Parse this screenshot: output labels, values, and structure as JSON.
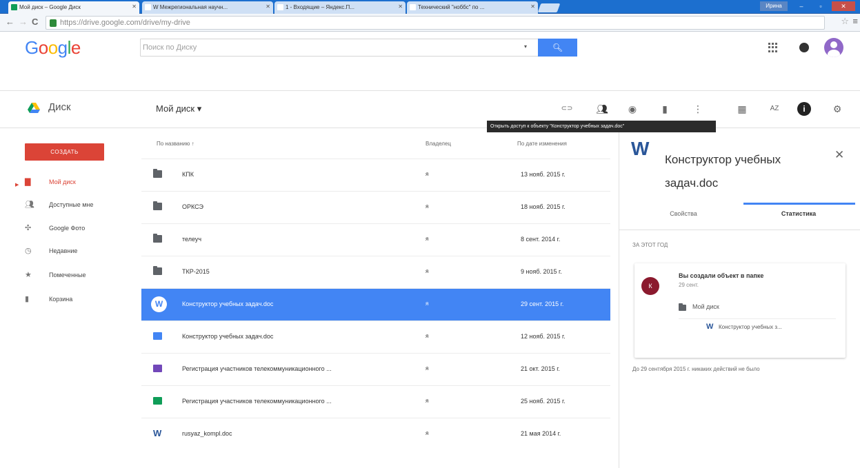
{
  "browser": {
    "tabs": [
      {
        "label": "Мой диск – Google Диск",
        "active": true,
        "favicon_color": "#0f9d58"
      },
      {
        "label": "W Межрегиональная научн...",
        "active": false,
        "favicon_color": "#ffffff"
      },
      {
        "label": "1 - Входящие – Яндекс.П...",
        "active": false,
        "favicon_color": "#ffffff"
      },
      {
        "label": "Технический \"ноббс\" по ...",
        "active": false,
        "favicon_color": "#ffffff"
      }
    ],
    "window_user": "Ирина",
    "url": "https://drive.google.com/drive/my-drive",
    "back_icon": "←",
    "forward_icon": "→",
    "reload_icon": "C",
    "star_icon": "☆",
    "menu_icon": "≡"
  },
  "header": {
    "logo": [
      "G",
      "o",
      "o",
      "g",
      "l",
      "e"
    ],
    "logo_colors": [
      "#4285f4",
      "#ea4335",
      "#fbbc05",
      "#4285f4",
      "#34a853",
      "#ea4335"
    ],
    "search_placeholder": "Поиск по Диску",
    "search_dropdown_icon": "▾",
    "search_button_icon": "🔍︎"
  },
  "subbar": {
    "app_title": "Диск",
    "breadcrumb": "Мой диск ▾",
    "tooltip": "Открыть доступ к объекту \"Конструктор учебных задач.doc\"",
    "toolbar": {
      "link_icon": "⊂⊃",
      "share_icon": "👥︎",
      "preview_icon": "◉",
      "trash_icon": "▮",
      "more_icon": "⋮",
      "grid_icon": "▦",
      "sort_icon": "AZ",
      "info_icon": "i",
      "settings_icon": "⚙"
    }
  },
  "leftnav": {
    "create_label": "СОЗДАТЬ",
    "items": [
      {
        "label": "Мой диск",
        "icon": "▇",
        "active": true
      },
      {
        "label": "Доступные мне",
        "icon": "👥︎",
        "active": false
      },
      {
        "label": "Google Фото",
        "icon": "✣",
        "active": false
      },
      {
        "label": "Недавние",
        "icon": "◷",
        "active": false
      },
      {
        "label": "Помеченные",
        "icon": "★",
        "active": false
      },
      {
        "label": "Корзина",
        "icon": "▮",
        "active": false
      }
    ]
  },
  "filelist": {
    "columns": {
      "name": "По названию ↑",
      "owner": "Владелец",
      "modified": "По дате изменения"
    },
    "rows": [
      {
        "name": "КПК",
        "type": "folder",
        "owner": "я",
        "date": "13 нояб. 2015 г."
      },
      {
        "name": "ОРКСЭ",
        "type": "folder",
        "owner": "я",
        "date": "18 нояб. 2015 г."
      },
      {
        "name": "телеуч",
        "type": "folder",
        "owner": "я",
        "date": "8 сент. 2014 г."
      },
      {
        "name": "ТКР-2015",
        "type": "folder",
        "owner": "я",
        "date": "9 нояб. 2015 г."
      },
      {
        "name": "Конструктор учебных задач.doc",
        "type": "word-selected",
        "owner": "я",
        "date": "29 сент. 2015 г."
      },
      {
        "name": "Конструктор учебных задач.doc",
        "type": "doc",
        "owner": "я",
        "date": "12 нояб. 2015 г."
      },
      {
        "name": "Регистрация участников телекоммуникационного ...",
        "type": "form",
        "owner": "я",
        "date": "21 окт. 2015 г."
      },
      {
        "name": "Регистрация участников телекоммуникационного ...",
        "type": "sheet",
        "owner": "я",
        "date": "25 нояб. 2015 г."
      },
      {
        "name": "rusyaz_kompl.doc",
        "type": "word",
        "owner": "я",
        "date": "21 мая 2014 г."
      }
    ]
  },
  "details": {
    "file_icon": "W",
    "title": "Конструктор учебных задач.doc",
    "close_icon": "✕",
    "tab_properties": "Свойства",
    "tab_activity": "Статистика",
    "period": "ЗА ЭТОТ ГОД",
    "activity": {
      "avatar_letter": "К",
      "text": "Вы создали объект в папке",
      "date": "29 сент.",
      "folder": "Мой диск",
      "file_icon": "W",
      "file": "Конструктор учебных з..."
    },
    "no_actions": "До 29 сентября 2015 г. никаких действий не было"
  }
}
